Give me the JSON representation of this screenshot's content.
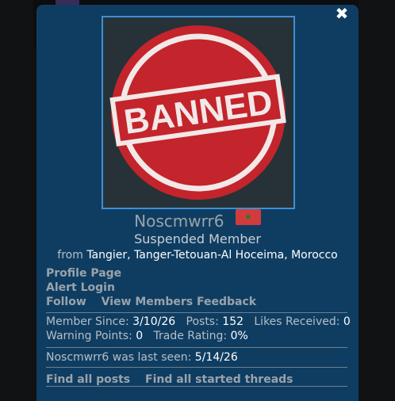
{
  "user": {
    "name": "Noscmwrr6",
    "title": "Suspended Member",
    "from_label": "from",
    "location": "Tangier, Tanger-Tetouan-Al Hoceima, Morocco"
  },
  "avatar": {
    "stamp_text": "BANNED",
    "stamp_color": "#c4242b"
  },
  "links": {
    "profile_page": "Profile Page",
    "alert_login": "Alert Login",
    "follow": "Follow",
    "view_feedback": "View Members Feedback"
  },
  "stats": {
    "member_since_label": "Member Since:",
    "member_since": "3/10/26",
    "posts_label": "Posts:",
    "posts": "152",
    "likes_label": "Likes Received:",
    "likes": "0",
    "warning_label": "Warning Points:",
    "warning": "0",
    "trade_label": "Trade Rating:",
    "trade": "0%",
    "last_seen_label": "Noscmwrr6 was last seen:",
    "last_seen": "5/14/26"
  },
  "finds": {
    "all_posts": "Find all posts",
    "all_threads": "Find all started threads"
  },
  "colors": {
    "modal_bg": "#0f3d62",
    "accent_border": "#3f8fd3"
  }
}
